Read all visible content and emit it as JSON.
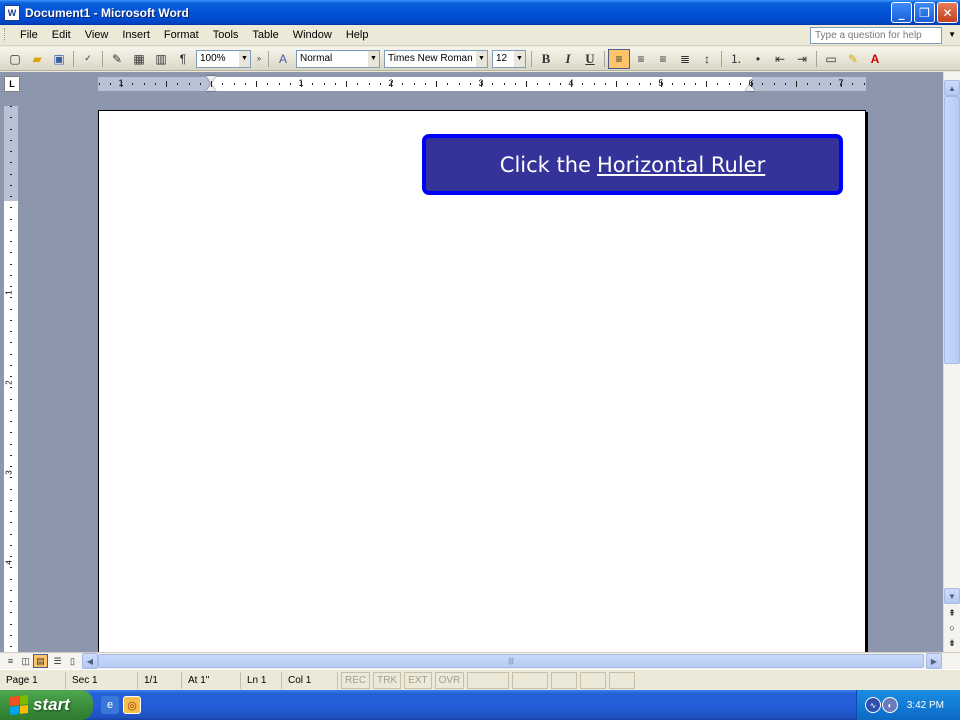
{
  "window": {
    "title": "Document1 - Microsoft Word",
    "app_icon": "word-doc-icon",
    "buttons": {
      "minimize": "_",
      "restore": "❐",
      "close": "✕"
    }
  },
  "menu": {
    "items": [
      "File",
      "Edit",
      "View",
      "Insert",
      "Format",
      "Tools",
      "Table",
      "Window",
      "Help"
    ],
    "help_placeholder": "Type a question for help"
  },
  "toolbar": {
    "zoom": "100%",
    "style": "Normal",
    "font": "Times New Roman",
    "size": "12",
    "bold": "B",
    "italic": "I",
    "underline": "U",
    "paragraph_mark": "¶"
  },
  "ruler": {
    "corner": "L",
    "labels": [
      "1",
      "1",
      "2",
      "3",
      "4",
      "5",
      "6",
      "7"
    ]
  },
  "vruler": {
    "labels": [
      "1",
      "2",
      "3",
      "4"
    ]
  },
  "callout": {
    "prefix": "Click the",
    "link": "Horizontal Ruler"
  },
  "status": {
    "page": "Page 1",
    "sec": "Sec 1",
    "pages": "1/1",
    "at": "At 1\"",
    "ln": "Ln 1",
    "col": "Col 1",
    "modes": [
      "REC",
      "TRK",
      "EXT",
      "OVR"
    ]
  },
  "taskbar": {
    "start_label": "start",
    "clock": "3:42 PM"
  },
  "colors": {
    "callout_bg": "#333399",
    "callout_border": "#0000ff",
    "titlebar": "#0353d8",
    "workspace": "#8c96ad"
  }
}
